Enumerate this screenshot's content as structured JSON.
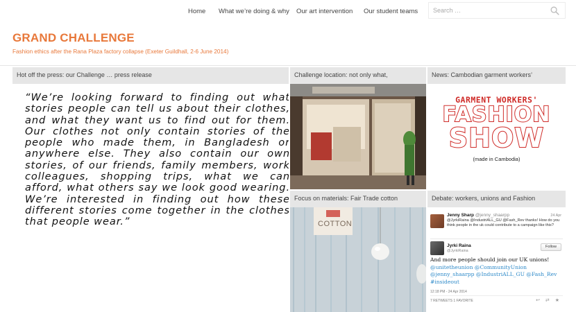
{
  "nav": {
    "items": [
      "Home",
      "What we’re doing & why",
      "Our art intervention",
      "Our student teams"
    ],
    "search_placeholder": "Search …"
  },
  "site": {
    "title": "GRAND CHALLENGE",
    "description": "Fashion ethics after the Rana Plaza factory collapse (Exeter Guildhall, 2-6 June 2014)"
  },
  "panels": {
    "press": {
      "title": "Hot off the press: our Challenge … press release",
      "quote": "“We’re looking forward to finding out what stories people can tell us about their clothes, and what they want us to find out for them. Our clothes not only contain stories of the people who made them, in Bangladesh or anywhere else. They also contain our own stories, of our friends, family members, work colleagues, shopping trips, what we can afford, what others say we look good wearing. We’re interested in finding out how these different stories come together in the clothes that people wear.”"
    },
    "location": {
      "title": "Challenge location: not only what,"
    },
    "news": {
      "title": "News: Cambodian garment workers’",
      "poster_line1": "GARMENT WORKERS'",
      "poster_line2": "FASHION",
      "poster_line3": "SHOW",
      "poster_line4": "(made in Cambodia)"
    },
    "materials": {
      "title": "Focus on materials: Fair Trade cotton",
      "sign_text": "COTTON"
    },
    "debate": {
      "title": "Debate: workers, unions and Fashion",
      "tweet1": {
        "name": "Jenny Sharp",
        "handle": "@jenny_shaarpp",
        "date": "24 Apr",
        "text": "@JyrkiRaina @IndustriALL_GU @Fash_Rev thanks! How do you think people in the uk could contribute to a campaign like this?"
      },
      "tweet2": {
        "name": "Jyrki Raina",
        "handle": "@JyrkiRaina",
        "follow_label": "Follow",
        "text_plain": "And more people should join our UK unions!",
        "mentions": "@unitetheunion @CommunityUnion @jenny_shaarpp @IndustriALL_GU @Fash_Rev #insideout",
        "time": "12:18 PM - 24 Apr 2014",
        "retweets": "7 RETWEETS",
        "favorites": "1 FAVORITE",
        "actions": "↩ ⇄ ★"
      }
    }
  },
  "colors": {
    "accent": "#e8783a",
    "panel_header": "#e6e6e6",
    "poster_red": "#cf2a27",
    "twitter_link": "#2e8ac9"
  },
  "icons": {
    "search": "magnifier"
  }
}
